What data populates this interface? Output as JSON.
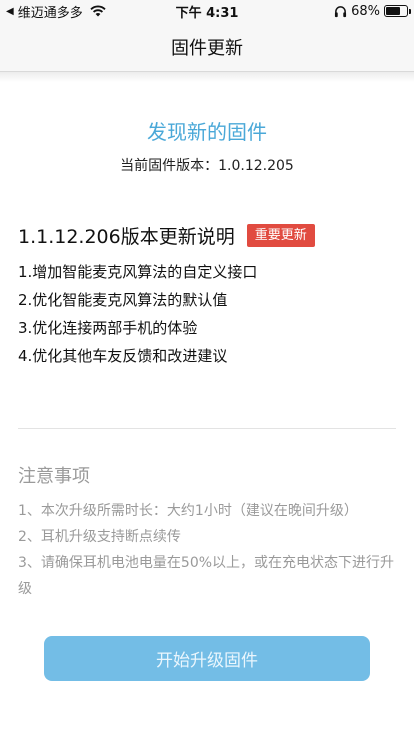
{
  "status_bar": {
    "carrier": "维迈通多多",
    "time": "下午 4:31",
    "battery": "68%",
    "battery_level": 0.68
  },
  "nav": {
    "title": "固件更新"
  },
  "firmware": {
    "found_title": "发现新的固件",
    "current_version": "当前固件版本：1.0.12.205"
  },
  "update": {
    "title": "1.1.12.206版本更新说明",
    "badge": "重要更新",
    "notes": [
      "1.增加智能麦克风算法的自定义接口",
      "2.优化智能麦克风算法的默认值",
      "3.优化连接两部手机的体验",
      "4.优化其他车友反馈和改进建议"
    ]
  },
  "notice": {
    "title": "注意事项",
    "items": [
      "1、本次升级所需时长：大约1小时（建议在晚间升级）",
      "2、耳机升级支持断点续传",
      "3、请确保耳机电池电量在50%以上，或在充电状态下进行升级"
    ]
  },
  "action": {
    "upgrade_label": "开始升级固件"
  }
}
